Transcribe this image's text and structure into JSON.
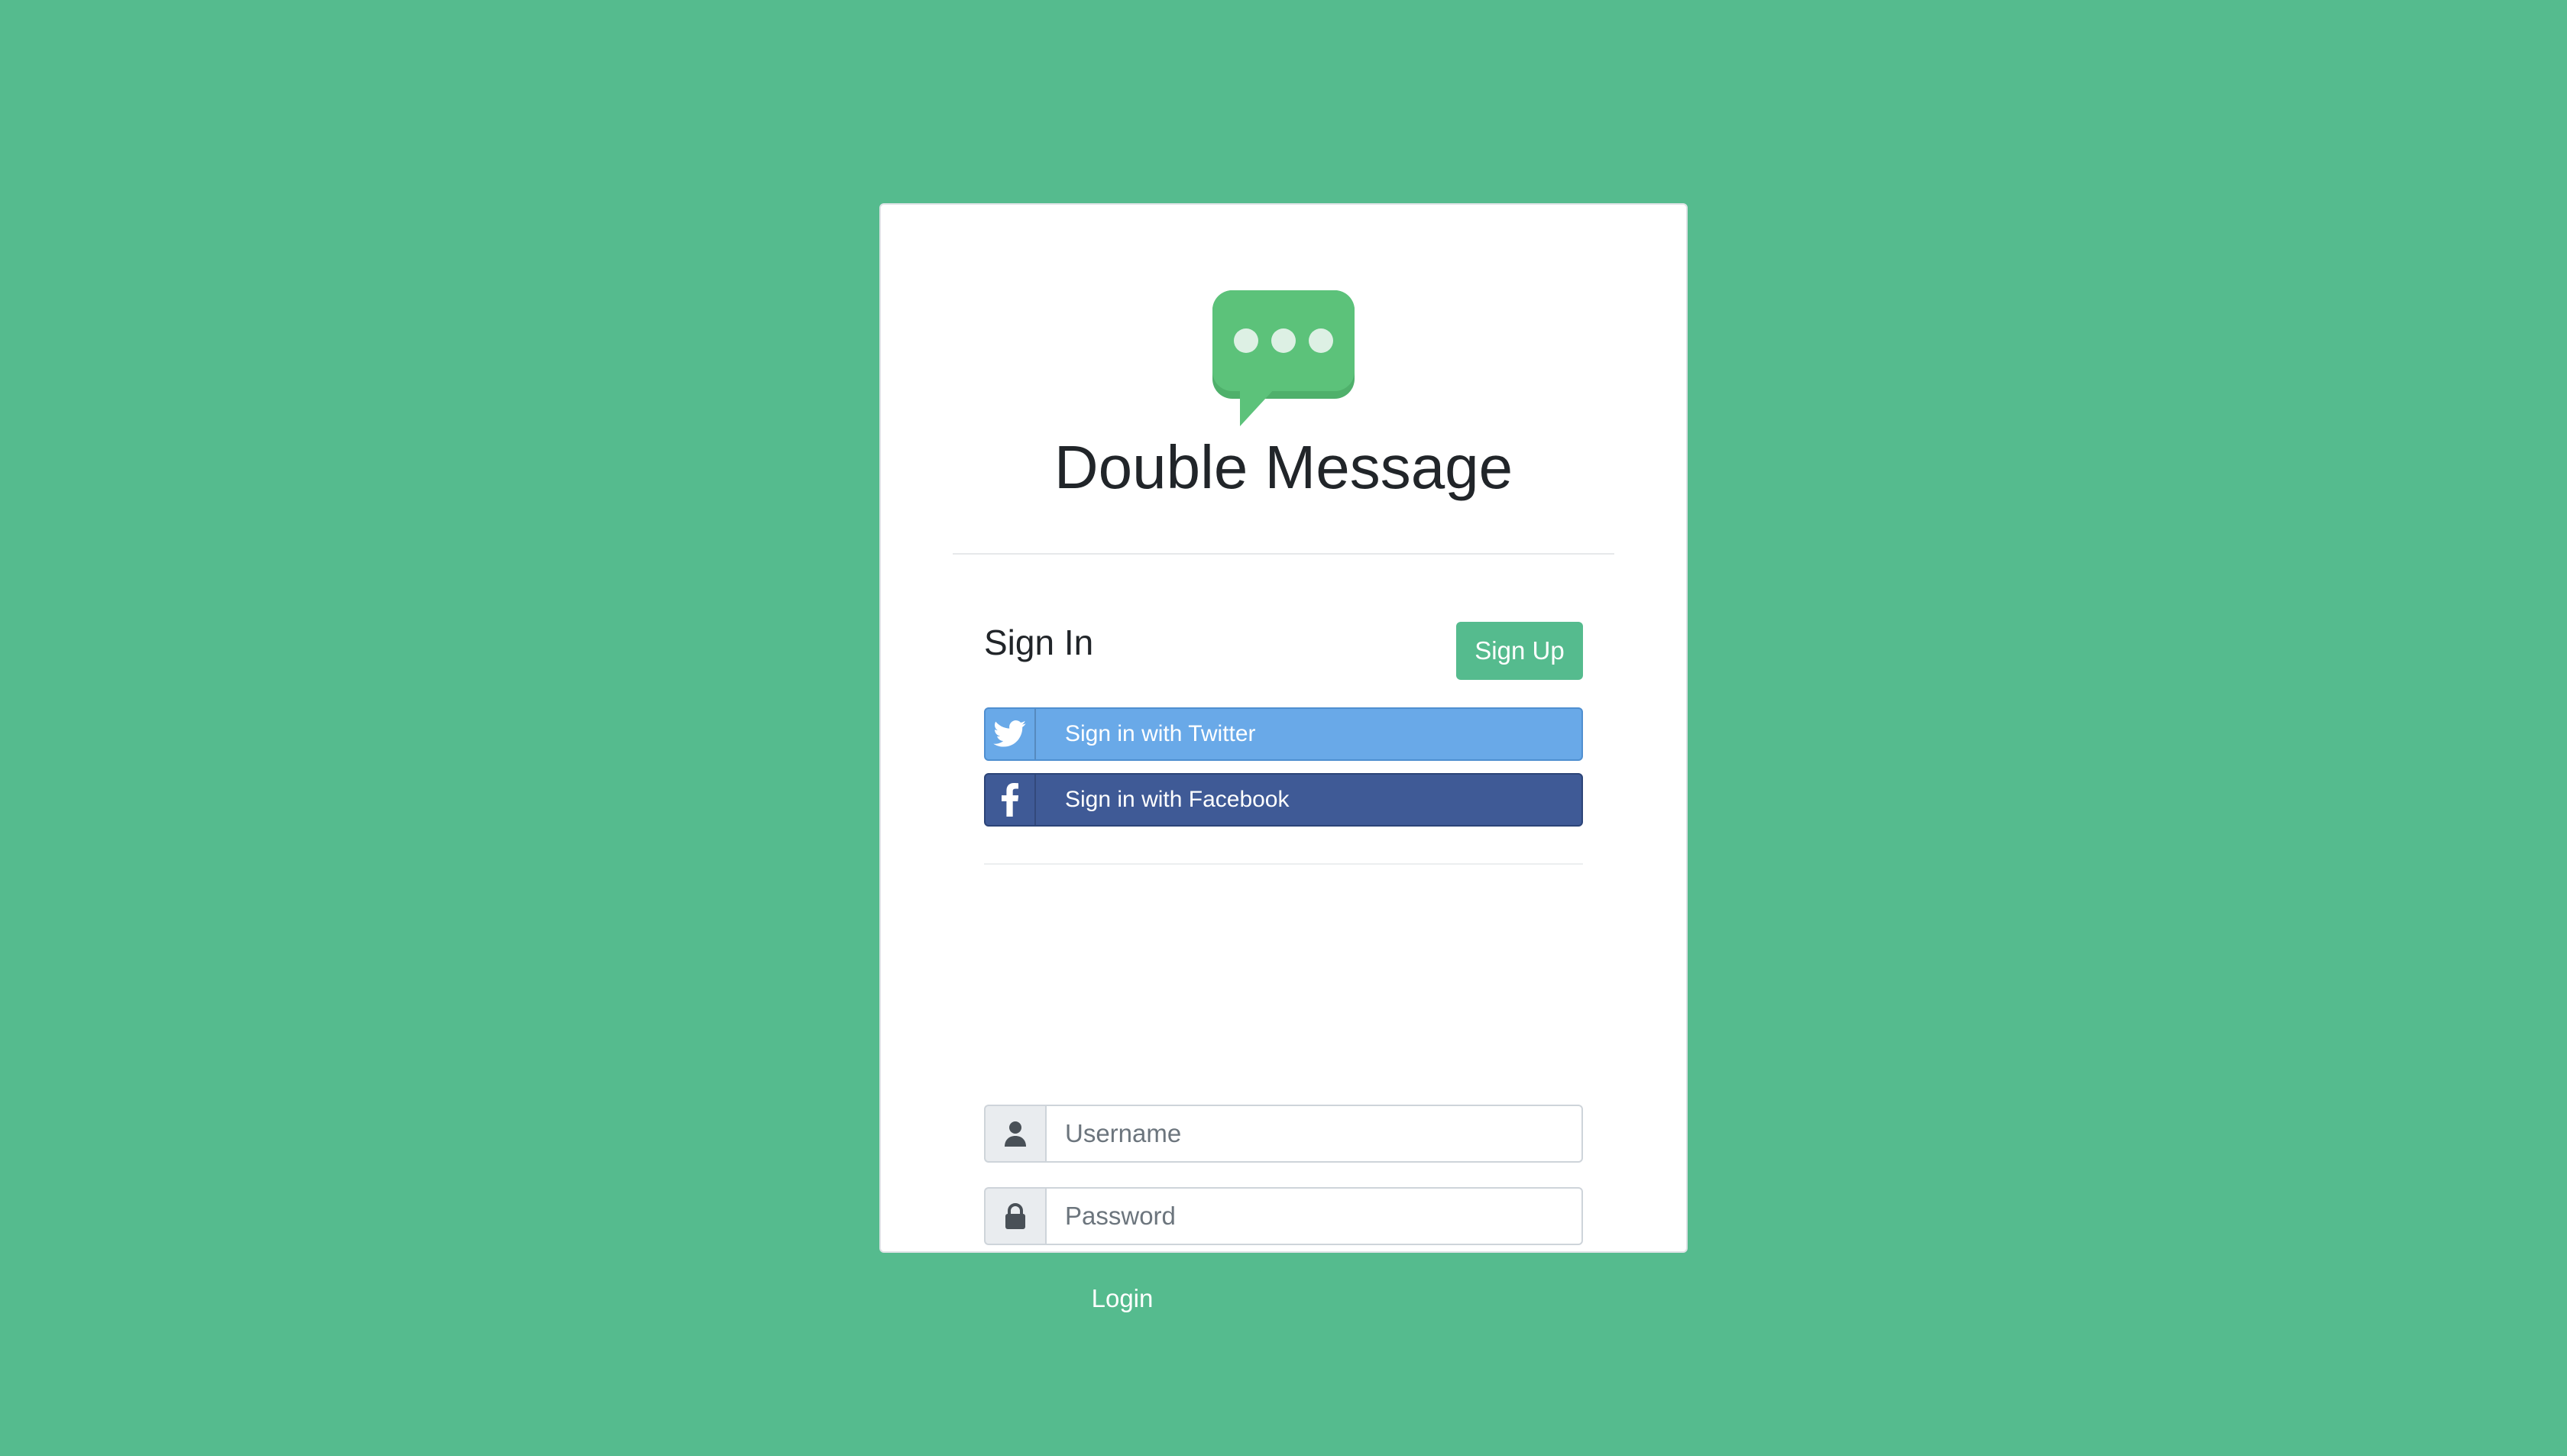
{
  "app": {
    "title": "Double Message",
    "logo_icon": "chat-bubble-icon",
    "logo_color": "#5cc27a"
  },
  "signin": {
    "heading": "Sign In",
    "signup_label": "Sign Up"
  },
  "social": {
    "twitter_label": "Sign in with Twitter",
    "twitter_color": "#69a9e8",
    "facebook_label": "Sign in with Facebook",
    "facebook_color": "#3f5a96"
  },
  "form": {
    "username_placeholder": "Username",
    "username_value": "",
    "password_placeholder": "Password",
    "password_value": "",
    "login_label": "Login"
  },
  "colors": {
    "background": "#55bb8e",
    "accent": "#55bb8e"
  }
}
